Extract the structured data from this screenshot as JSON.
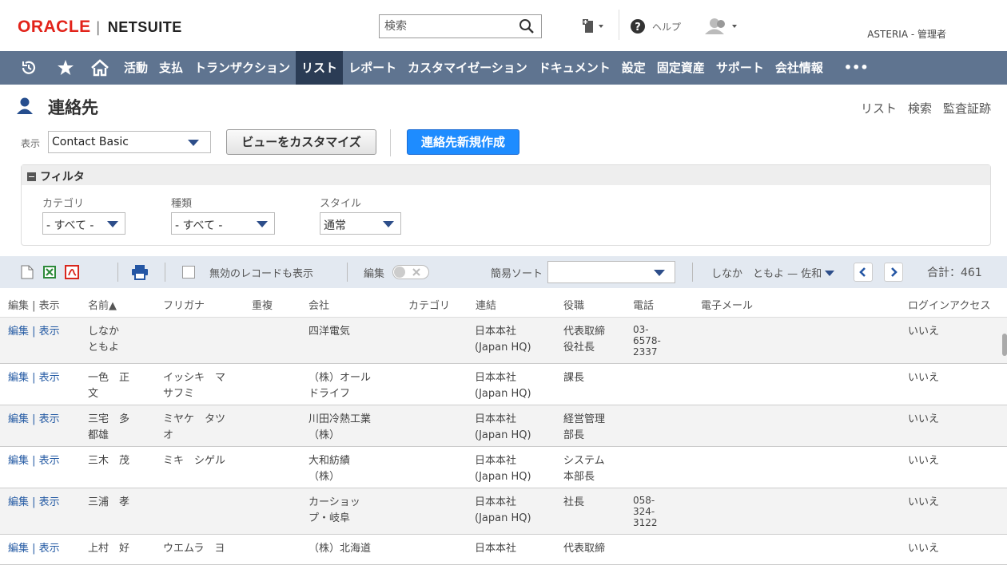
{
  "header": {
    "logo_oracle": "ORACLE",
    "logo_netsuite": "NETSUITE",
    "search_placeholder": "検索",
    "help_label": "ヘルプ",
    "user_name": "ASTERIA - 管理者"
  },
  "nav": {
    "items": [
      "活動",
      "支払",
      "トランザクション",
      "リスト",
      "レポート",
      "カスタマイゼーション",
      "ドキュメント",
      "設定",
      "固定資産",
      "サポート",
      "会社情報"
    ],
    "active": "リスト",
    "more": "•••"
  },
  "page": {
    "title": "連絡先",
    "links": [
      "リスト",
      "検索",
      "監査証跡"
    ]
  },
  "controls": {
    "view_label": "表示",
    "view_value": "Contact Basic",
    "customize_label": "ビューをカスタマイズ",
    "new_label": "連絡先新規作成"
  },
  "filter": {
    "title": "フィルタ",
    "fields": [
      {
        "label": "カテゴリ",
        "value": "- すべて -"
      },
      {
        "label": "種類",
        "value": "- すべて -"
      },
      {
        "label": "スタイル",
        "value": "通常"
      }
    ]
  },
  "toolbar": {
    "inactive_label": "無効のレコードも表示",
    "edit_label": "編集",
    "quicksort_label": "簡易ソート",
    "range_label": "しなか　ともよ — 佐和",
    "total_label": "合計：461"
  },
  "table": {
    "columns": [
      "編集 | 表示",
      "名前▲",
      "フリガナ",
      "重複",
      "会社",
      "カテゴリ",
      "連結",
      "役職",
      "電話",
      "電子メール",
      "ログインアクセス"
    ],
    "rows": [
      {
        "edit": "編集 | 表示",
        "name": [
          "しなか",
          "ともよ"
        ],
        "kana": [],
        "company": [
          "四洋電気"
        ],
        "sub": [
          "日本本社",
          "(Japan HQ)"
        ],
        "title": [
          "代表取締",
          "役社長"
        ],
        "phone": [
          "03-",
          "6578-",
          "2337"
        ],
        "login": "いいえ"
      },
      {
        "edit": "編集 | 表示",
        "name": [
          "一色　正",
          "文"
        ],
        "kana": [
          "イッシキ　マ",
          "サフミ"
        ],
        "company": [
          "（株）オール",
          "ドライフ"
        ],
        "sub": [
          "日本本社",
          "(Japan HQ)"
        ],
        "title": [
          "課長"
        ],
        "phone": [],
        "login": "いいえ"
      },
      {
        "edit": "編集 | 表示",
        "name": [
          "三宅　多",
          "都雄"
        ],
        "kana": [
          "ミヤケ　タツ",
          "オ"
        ],
        "company": [
          "川田冷熱工業",
          "（株）"
        ],
        "sub": [
          "日本本社",
          "(Japan HQ)"
        ],
        "title": [
          "経営管理",
          "部長"
        ],
        "phone": [],
        "login": "いいえ"
      },
      {
        "edit": "編集 | 表示",
        "name": [
          "三木　茂"
        ],
        "kana": [
          "ミキ　シゲル"
        ],
        "company": [
          "大和紡績",
          "（株）"
        ],
        "sub": [
          "日本本社",
          "(Japan HQ)"
        ],
        "title": [
          "システム",
          "本部長"
        ],
        "phone": [],
        "login": "いいえ"
      },
      {
        "edit": "編集 | 表示",
        "name": [
          "三浦　孝"
        ],
        "kana": [],
        "company": [
          "カーショッ",
          "プ・岐阜"
        ],
        "sub": [
          "日本本社",
          "(Japan HQ)"
        ],
        "title": [
          "社長"
        ],
        "phone": [
          "058-",
          "324-",
          "3122"
        ],
        "login": "いいえ"
      },
      {
        "edit": "編集 | 表示",
        "name": [
          "上村　好"
        ],
        "kana": [
          "ウエムラ　ヨ"
        ],
        "company": [
          "（株）北海道"
        ],
        "sub": [
          "日本本社"
        ],
        "title": [
          "代表取締"
        ],
        "phone": [],
        "login": "いいえ"
      }
    ]
  },
  "colors": {
    "nav_bg": "#5f7490",
    "nav_active": "#2b3c55",
    "primary_button": "#1e8cff",
    "oracle_red": "#e2231a",
    "link": "#255ba4"
  },
  "icons": [
    "history-icon",
    "star-icon",
    "home-icon",
    "search-icon",
    "create-new-icon",
    "help-icon",
    "user-icon",
    "contact-icon",
    "caret-down-icon",
    "export-csv-icon",
    "export-excel-icon",
    "export-pdf-icon",
    "print-icon",
    "prev-icon",
    "next-icon"
  ]
}
